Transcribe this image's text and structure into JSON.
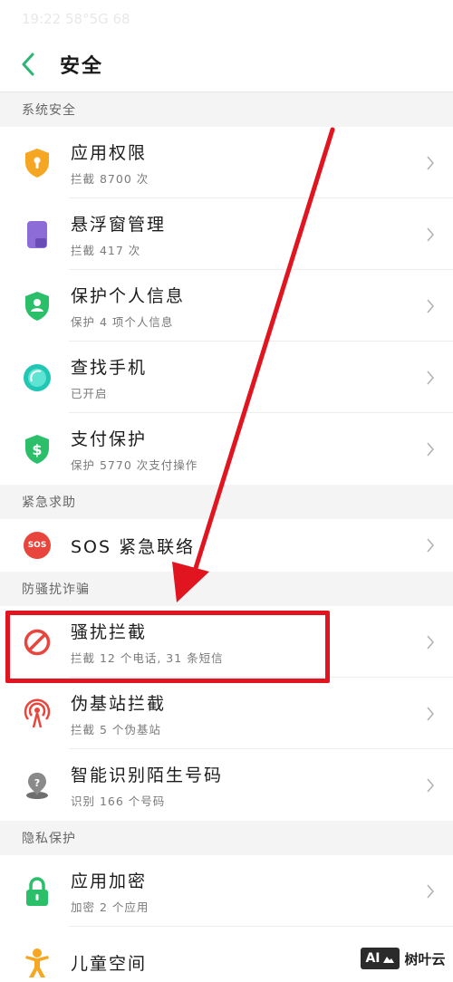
{
  "status_bar": {
    "text": "19:22 58°5G 68"
  },
  "header": {
    "title": "安全"
  },
  "sections": {
    "system": {
      "label": "系统安全",
      "items": [
        {
          "title": "应用权限",
          "subtitle": "拦截 8700 次"
        },
        {
          "title": "悬浮窗管理",
          "subtitle": "拦截 417 次"
        },
        {
          "title": "保护个人信息",
          "subtitle": "保护 4 项个人信息"
        },
        {
          "title": "查找手机",
          "subtitle": "已开启"
        },
        {
          "title": "支付保护",
          "subtitle": "保护 5770 次支付操作"
        }
      ]
    },
    "emergency": {
      "label": "紧急求助",
      "items": [
        {
          "title": "SOS 紧急联络",
          "icon_text": "SOS"
        }
      ]
    },
    "anti_fraud": {
      "label": "防骚扰诈骗",
      "items": [
        {
          "title": "骚扰拦截",
          "subtitle": "拦截 12 个电话, 31 条短信"
        },
        {
          "title": "伪基站拦截",
          "subtitle": "拦截 5 个伪基站"
        },
        {
          "title": "智能识别陌生号码",
          "subtitle": "识别 166 个号码"
        }
      ]
    },
    "privacy": {
      "label": "隐私保护",
      "items": [
        {
          "title": "应用加密",
          "subtitle": "加密 2 个应用"
        },
        {
          "title": "儿童空间"
        }
      ]
    }
  },
  "watermark": {
    "badge": "AI",
    "text": "树叶云"
  },
  "colors": {
    "accent": "#2bb673",
    "highlight": "#e01520",
    "shield_orange": "#f5a623",
    "shield_green": "#2bbf6a",
    "purple": "#8e6cd8",
    "teal": "#20c7b5",
    "red_icon": "#e8453c"
  }
}
